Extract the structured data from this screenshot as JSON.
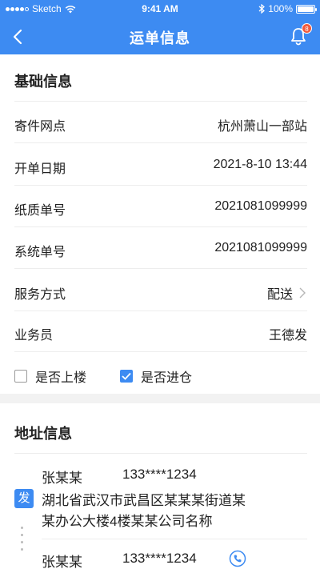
{
  "status_bar": {
    "carrier": "Sketch",
    "time": "9:41 AM",
    "battery": "100%"
  },
  "nav": {
    "title": "运单信息",
    "badge_count": "8",
    "icons": {
      "back": "back-arrow-icon",
      "notification": "bell-icon"
    }
  },
  "basic_info": {
    "title": "基础信息",
    "rows": [
      {
        "label": "寄件网点",
        "value": "杭州萧山一部站"
      },
      {
        "label": "开单日期",
        "value": "2021-8-10 13:44"
      },
      {
        "label": "纸质单号",
        "value": "2021081099999"
      },
      {
        "label": "系统单号",
        "value": "2021081099999"
      },
      {
        "label": "服务方式",
        "value": "配送"
      },
      {
        "label": "业务员",
        "value": "王德发"
      }
    ],
    "checkboxes": [
      {
        "label": "是否上楼",
        "checked": false
      },
      {
        "label": "是否进仓",
        "checked": true
      }
    ]
  },
  "address_info": {
    "title": "地址信息",
    "sender": {
      "tag": "发",
      "name": "张某某",
      "phone": "133****1234",
      "address_line1": "湖北省武汉市武昌区某某某街道某",
      "address_line2": "某办公大楼4楼某某公司名称"
    },
    "receiver": {
      "name": "张某某",
      "phone": "133****1234"
    }
  },
  "colors": {
    "primary": "#3d8bf2",
    "badge": "#f05a3c",
    "divider": "#ededed",
    "section_gap": "#f2f2f2"
  }
}
